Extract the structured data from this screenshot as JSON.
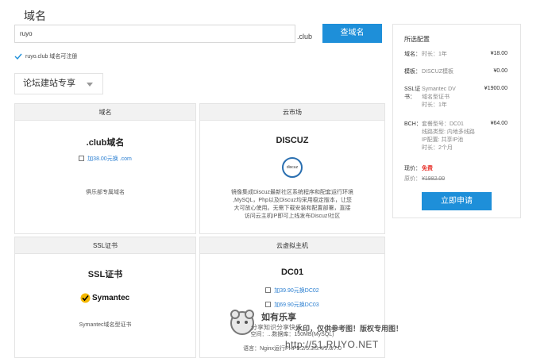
{
  "page_title": "域名",
  "search": {
    "value": "ruyo",
    "suffix": ".club",
    "button": "查域名"
  },
  "availability": "ruyo.club 域名可注册",
  "forum_select": "论坛建站专享",
  "cards": {
    "domain": {
      "header": "域名",
      "title": ".club域名",
      "option": "加38.00元换 .com",
      "desc": "俱乐部专属域名"
    },
    "market": {
      "header": "云市场",
      "title": "DISCUZ",
      "logo_text": "discuz",
      "desc_lines": [
        "镜像集成Discuz最新社区系统程序和配套运行环境",
        ",MySQL，Php以及Discuz均采用稳定版本，让您",
        "大可放心使用。无需下载安装和配置部署，直接",
        "访问云主机IP即可上线发布Discuz!社区"
      ]
    },
    "ssl": {
      "header": "SSL证书",
      "title": "SSL证书",
      "logo": "Symantec",
      "desc": "Symantec域名型证书"
    },
    "vhost": {
      "header": "云虚拟主机",
      "title": "DC01",
      "options": [
        "加39.90元换DC02",
        "加69.90元换DC03"
      ],
      "spec_lines": [
        "空间：...数据库：150MB(MySQL)",
        "语言：Nginx运行PHP5.2/5.3/5.4/5.6/7.0"
      ]
    }
  },
  "sidebar": {
    "title": "所选配置",
    "items": [
      {
        "label": "域名：",
        "desc": [
          "时长：1年"
        ],
        "price": "¥18.00"
      },
      {
        "label": "模板：",
        "desc": [
          "DISCUZ模板"
        ],
        "price": "¥0.00"
      },
      {
        "label": "SSL证书：",
        "desc": [
          "Symantec DV",
          "域名型证书",
          "时长：1年"
        ],
        "price": "¥1900.00"
      },
      {
        "label": "BCH：",
        "desc": [
          "套餐型号：DC01",
          "线路类型: 内地多线路",
          "IP配置: 共享IP池",
          "时长：2个月"
        ],
        "price": "¥64.00"
      }
    ],
    "now_price_label": "现价：",
    "now_price": "免费",
    "orig_price_label": "原价：",
    "orig_price": "¥1982.00",
    "apply": "立即申请"
  },
  "watermark": {
    "name": "如有乐享",
    "slogan": "分享知识分享快乐",
    "notice": "水印，仅供参考图！版权专用图！",
    "url": "http://51.RUYO.NET"
  }
}
